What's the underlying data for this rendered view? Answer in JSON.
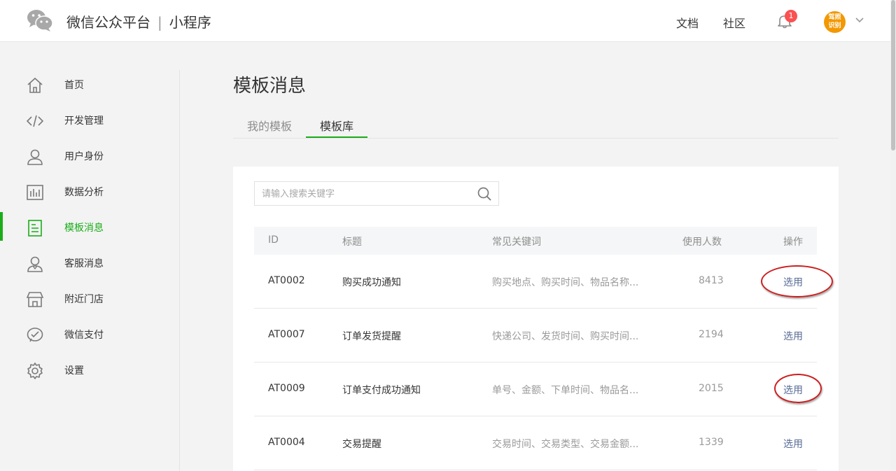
{
  "header": {
    "brand_main": "微信公众平台",
    "brand_separator": "|",
    "brand_sub": "小程序",
    "links": [
      "文档",
      "社区"
    ],
    "notification_count": "1",
    "avatar_text": "驾照识别"
  },
  "sidebar": {
    "items": [
      {
        "label": "首页",
        "icon": "home-icon"
      },
      {
        "label": "开发管理",
        "icon": "code-icon"
      },
      {
        "label": "用户身份",
        "icon": "user-icon"
      },
      {
        "label": "数据分析",
        "icon": "bar-chart-icon"
      },
      {
        "label": "模板消息",
        "icon": "template-doc-icon",
        "active": true
      },
      {
        "label": "客服消息",
        "icon": "customer-service-icon"
      },
      {
        "label": "附近门店",
        "icon": "store-icon"
      },
      {
        "label": "微信支付",
        "icon": "wechat-pay-icon"
      },
      {
        "label": "设置",
        "icon": "gear-icon"
      }
    ]
  },
  "page": {
    "title": "模板消息",
    "tabs": [
      {
        "label": "我的模板",
        "active": false
      },
      {
        "label": "模板库",
        "active": true
      }
    ]
  },
  "search": {
    "placeholder": "请输入搜索关键字",
    "value": ""
  },
  "table": {
    "headers": [
      "ID",
      "标题",
      "常见关键词",
      "使用人数",
      "操作"
    ],
    "rows": [
      {
        "id": "AT0002",
        "title": "购买成功通知",
        "keywords": "购买地点、购买时间、物品名称...",
        "count": "8413",
        "action": "选用"
      },
      {
        "id": "AT0007",
        "title": "订单发货提醒",
        "keywords": "快递公司、发货时间、购买时间...",
        "count": "2194",
        "action": "选用"
      },
      {
        "id": "AT0009",
        "title": "订单支付成功通知",
        "keywords": "单号、金额、下单时间、物品名...",
        "count": "2015",
        "action": "选用"
      },
      {
        "id": "AT0004",
        "title": "交易提醒",
        "keywords": "交易时间、交易类型、交易金额...",
        "count": "1339",
        "action": "选用"
      }
    ]
  },
  "colors": {
    "accent_green": "#1aad19",
    "link_blue": "#576b95",
    "badge_red": "#fa5151",
    "annotation_red": "#cc1f1f"
  }
}
